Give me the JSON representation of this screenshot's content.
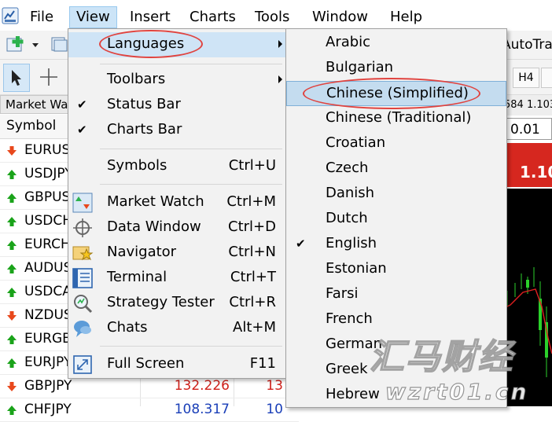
{
  "menubar": {
    "items": [
      {
        "label": "File"
      },
      {
        "label": "View"
      },
      {
        "label": "Insert"
      },
      {
        "label": "Charts"
      },
      {
        "label": "Tools"
      },
      {
        "label": "Window"
      },
      {
        "label": "Help"
      }
    ]
  },
  "toolbar": {
    "autotrading_label": "AutoTra",
    "timeframe_h4": "H4"
  },
  "market_watch": {
    "title": "Market Wa",
    "column_symbol": "Symbol",
    "rows": [
      {
        "symbol": "EURUSD",
        "direction": "down",
        "bid": "",
        "ask": ""
      },
      {
        "symbol": "USDJPY",
        "direction": "up",
        "bid": "",
        "ask": ""
      },
      {
        "symbol": "GBPUSD",
        "direction": "up",
        "bid": "",
        "ask": ""
      },
      {
        "symbol": "USDCHF",
        "direction": "up",
        "bid": "",
        "ask": ""
      },
      {
        "symbol": "EURCHF",
        "direction": "up",
        "bid": "",
        "ask": ""
      },
      {
        "symbol": "AUDUSD",
        "direction": "up",
        "bid": "",
        "ask": ""
      },
      {
        "symbol": "USDCAD",
        "direction": "up",
        "bid": "",
        "ask": ""
      },
      {
        "symbol": "NZDUSD",
        "direction": "down",
        "bid": "",
        "ask": ""
      },
      {
        "symbol": "EURGBP",
        "direction": "up",
        "bid": "",
        "ask": ""
      },
      {
        "symbol": "EURJPY",
        "direction": "up",
        "bid": "",
        "ask": ""
      },
      {
        "symbol": "GBPJPY",
        "direction": "down",
        "bid": "132.226",
        "ask": "13"
      },
      {
        "symbol": "CHFJPY",
        "direction": "up",
        "bid": "108.317",
        "ask": "10"
      }
    ]
  },
  "trade_panel": {
    "header_quote": "584 1.103",
    "lot_value": "0.01",
    "sell_price": "1.10"
  },
  "view_menu": {
    "items": [
      {
        "label": "Languages",
        "shortcut": "",
        "submenu": true
      },
      {
        "label": "Toolbars",
        "shortcut": "",
        "submenu": true
      },
      {
        "label": "Status Bar",
        "shortcut": "",
        "checked": true
      },
      {
        "label": "Charts Bar",
        "shortcut": "",
        "checked": true
      },
      {
        "label": "Symbols",
        "shortcut": "Ctrl+U"
      },
      {
        "label": "Market Watch",
        "shortcut": "Ctrl+M"
      },
      {
        "label": "Data Window",
        "shortcut": "Ctrl+D"
      },
      {
        "label": "Navigator",
        "shortcut": "Ctrl+N"
      },
      {
        "label": "Terminal",
        "shortcut": "Ctrl+T"
      },
      {
        "label": "Strategy Tester",
        "shortcut": "Ctrl+R"
      },
      {
        "label": "Chats",
        "shortcut": "Alt+M"
      },
      {
        "label": "Full Screen",
        "shortcut": "F11"
      }
    ]
  },
  "languages_menu": {
    "items": [
      {
        "label": "Arabic"
      },
      {
        "label": "Bulgarian"
      },
      {
        "label": "Chinese (Simplified)",
        "highlighted": true
      },
      {
        "label": "Chinese (Traditional)"
      },
      {
        "label": "Croatian"
      },
      {
        "label": "Czech"
      },
      {
        "label": "Danish"
      },
      {
        "label": "Dutch"
      },
      {
        "label": "English",
        "checked": true
      },
      {
        "label": "Estonian"
      },
      {
        "label": "Farsi"
      },
      {
        "label": "French"
      },
      {
        "label": "German"
      },
      {
        "label": "Greek"
      },
      {
        "label": "Hebrew"
      }
    ]
  },
  "watermark": {
    "text_cn": "汇马财经",
    "text_url": "wzrt01.cn"
  },
  "colors": {
    "up_arrow": "#1aa31a",
    "down_arrow": "#e8481c",
    "menu_highlight": "#cfe4f6",
    "annotation_red": "#e0433f",
    "sell_red": "#d6271f",
    "bid_red": "#d0211b",
    "bid_blue": "#1a3fb8"
  }
}
